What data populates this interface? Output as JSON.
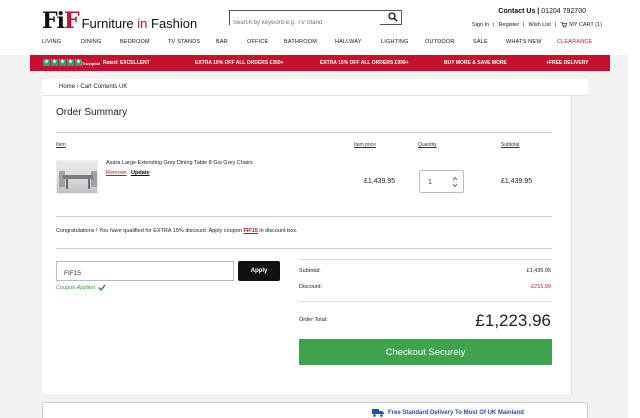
{
  "brand": {
    "mark_left": "Fi",
    "mark_mid": "F",
    "text": "Furniture",
    "text_in": "in",
    "text_end": "Fashion"
  },
  "search": {
    "placeholder": "Search by keyword e.g. TV Stand"
  },
  "contact": {
    "label": "Contact Us",
    "phone": "01204 792700"
  },
  "account": {
    "sign_in": "Sign In",
    "register": "Register",
    "wishlist": "Wish List",
    "cart": "MY CART (1)"
  },
  "nav": [
    "LIVING",
    "DINING",
    "BEDROOM",
    "TV STANDS",
    "BAR",
    "OFFICE",
    "BATHROOM",
    "HALLWAY",
    "LIGHTING",
    "OUTDOOR",
    "SALE",
    "WHATS NEW",
    "CLEARANCE"
  ],
  "promo": {
    "trustpilot": "Trustpilot",
    "rated": "Rated: EXCELLENT",
    "offer1": "EXTRA 10% OFF ALL ORDERS £350+",
    "offer2": "EXTRA 15% OFF ALL ORDERS £999+",
    "offer3": "BUY MORE & SAVE MORE",
    "offer4": "+FREE DELIVERY"
  },
  "breadcrumb": {
    "home": "Home",
    "current": "Cart Contents UK"
  },
  "order": {
    "title": "Order Summary",
    "col_item": "Item",
    "col_price": "Item price",
    "col_qty": "Quantity",
    "col_subtotal": "Subtotal",
    "item_name": "Axara Large Extending Grey Dining Table 8 Gia Grey Chairs",
    "remove": "Remove",
    "update": "Update",
    "price": "£1,439.95",
    "qty": "1",
    "subtotal": "£1,439.95"
  },
  "congrats": {
    "text": "Congratulations ! You have qualified for EXTRA 15% discount. Apply coupon",
    "code": "FIF15",
    "tail": "in discount box."
  },
  "coupon": {
    "value": "FIF15",
    "apply": "Apply",
    "applied": "Coupon Applied"
  },
  "totals": {
    "subtotal_label": "Subtotal:",
    "subtotal": "£1,439.95",
    "discount_label": "Discount:",
    "discount": "-£215.99",
    "total_label": "Order Total:",
    "total": "£1,223.96"
  },
  "checkout": "Checkout Securely",
  "delivery": "Free Standard Delivery To Most Of UK Mainland",
  "colors": {
    "brand_red": "#c8102e",
    "checkout_green": "#3fa34d",
    "trustpilot_green": "#00b67a",
    "delivery_blue": "#1f4fb5"
  }
}
